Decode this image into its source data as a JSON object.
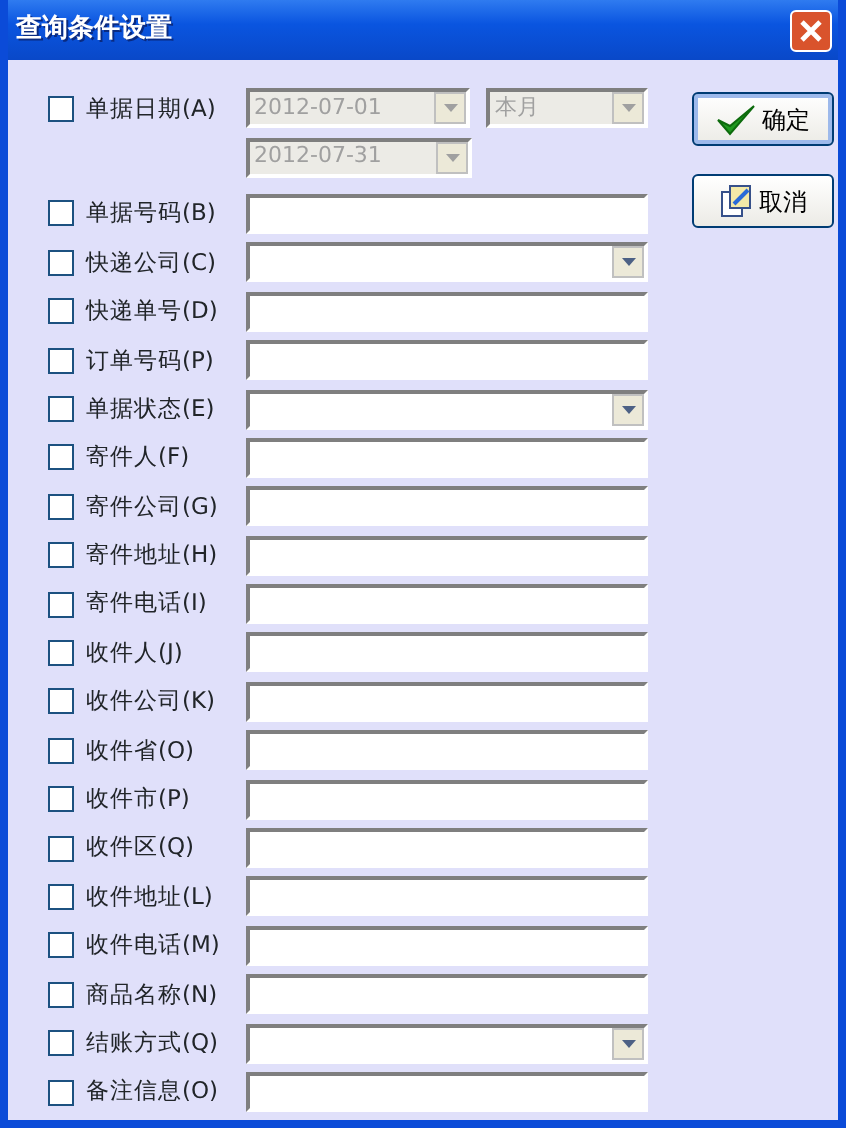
{
  "window": {
    "title": "查询条件设置"
  },
  "date_row": {
    "label": "单据日期(A)",
    "checked": false,
    "start": "2012-07-01",
    "end": "2012-07-31",
    "period": "本月",
    "disabled": true
  },
  "rows": [
    {
      "label": "单据号码(B)",
      "kind": "text",
      "checked": false
    },
    {
      "label": "快递公司(C)",
      "kind": "combo",
      "checked": false
    },
    {
      "label": "快递单号(D)",
      "kind": "text",
      "checked": false
    },
    {
      "label": "订单号码(P)",
      "kind": "text",
      "checked": false
    },
    {
      "label": "单据状态(E)",
      "kind": "combo",
      "checked": false
    },
    {
      "label": "寄件人(F)",
      "kind": "text",
      "checked": false
    },
    {
      "label": "寄件公司(G)",
      "kind": "text",
      "checked": false
    },
    {
      "label": "寄件地址(H)",
      "kind": "text",
      "checked": false
    },
    {
      "label": "寄件电话(I)",
      "kind": "text",
      "checked": false
    },
    {
      "label": "收件人(J)",
      "kind": "text",
      "checked": false
    },
    {
      "label": "收件公司(K)",
      "kind": "text",
      "checked": false
    },
    {
      "label": "收件省(O)",
      "kind": "text",
      "checked": false
    },
    {
      "label": "收件市(P)",
      "kind": "text",
      "checked": false
    },
    {
      "label": "收件区(Q)",
      "kind": "text",
      "checked": false
    },
    {
      "label": "收件地址(L)",
      "kind": "text",
      "checked": false
    },
    {
      "label": "收件电话(M)",
      "kind": "text",
      "checked": false
    },
    {
      "label": "商品名称(N)",
      "kind": "text",
      "checked": false
    },
    {
      "label": "结账方式(Q)",
      "kind": "combo",
      "checked": false
    },
    {
      "label": "备注信息(O)",
      "kind": "text",
      "checked": false
    }
  ],
  "buttons": [
    {
      "label": "确定",
      "kind": "ok",
      "default": true
    },
    {
      "label": "取消",
      "kind": "cancel",
      "default": false
    }
  ]
}
